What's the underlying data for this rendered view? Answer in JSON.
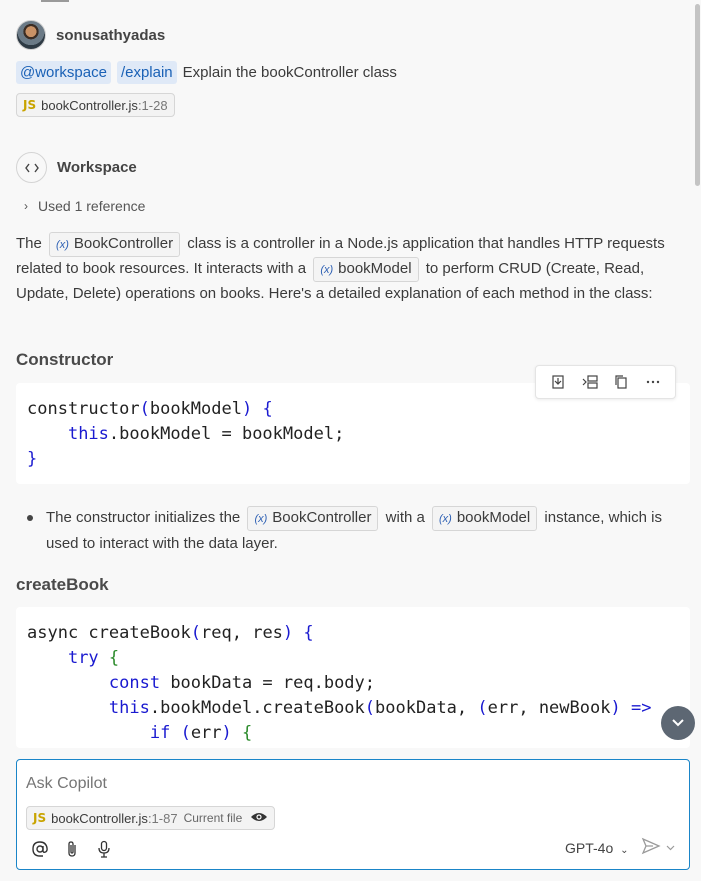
{
  "user": {
    "name": "sonusathyadas"
  },
  "prompt": {
    "agent": "@workspace",
    "command": "/explain",
    "text": "Explain the bookController class"
  },
  "attached_file": {
    "badge": "JS",
    "name": "bookController.js",
    "range": ":1-28"
  },
  "response": {
    "source": "Workspace",
    "references": "Used 1 reference",
    "intro": {
      "p1": "The",
      "sym1": "BookController",
      "p2": "class is a controller in a Node.js application that handles HTTP requests related to book resources. It interacts with a",
      "sym2": "bookModel",
      "p3": "to perform CRUD (Create, Read, Update, Delete) operations on books. Here's a detailed explanation of each method in the class:"
    },
    "sections": [
      {
        "heading": "Constructor"
      },
      {
        "heading": "createBook"
      }
    ],
    "bullet": {
      "p1": "The constructor initializes the",
      "sym1": "BookController",
      "p2": "with a",
      "sym2": "bookModel",
      "p3": "instance, which is used to interact with the data layer."
    },
    "symbol_marker": "(x)"
  },
  "input": {
    "placeholder": "Ask Copilot",
    "context_badge": "JS",
    "context_file": "bookController.js",
    "context_range": ":1-87",
    "context_label": "Current file",
    "model": "GPT-4o"
  },
  "icons": {
    "at": "@",
    "attach": "paperclip-icon",
    "mic": "microphone-icon",
    "send": "send-icon"
  },
  "colors": {
    "accent": "#1a85c8",
    "keyword": "#1a1ad0",
    "bracket_green": "#2a8a2a",
    "chip_blue_bg": "#dfe9f7"
  }
}
